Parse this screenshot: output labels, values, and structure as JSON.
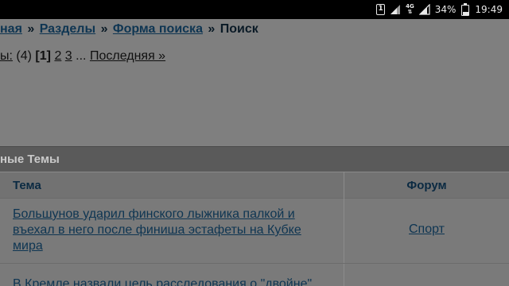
{
  "status_bar": {
    "sim_badge": "1",
    "network": "4G",
    "battery": "34%",
    "battery_level": 0.34,
    "time": "19:49"
  },
  "breadcrumb": {
    "items": [
      "ная",
      "Разделы",
      "Форма поиска"
    ],
    "current": "Поиск",
    "separator": "»"
  },
  "pagination": {
    "label": "ы:",
    "count": "(4)",
    "current": "[1]",
    "pages": [
      "2",
      "3"
    ],
    "ellipsis": "...",
    "last": "Последняя »"
  },
  "panel": {
    "title": "ные Темы"
  },
  "table": {
    "headers": {
      "topic": "Тема",
      "forum": "Форум"
    },
    "rows": [
      {
        "topic": "Большунов ударил финского лыжника палкой и въехал в него после финиша эстафеты на Кубке мира",
        "forum": "Спорт"
      },
      {
        "topic": "В Кремле назвали цель расследования о \"двойне\"",
        "forum": ""
      }
    ]
  }
}
